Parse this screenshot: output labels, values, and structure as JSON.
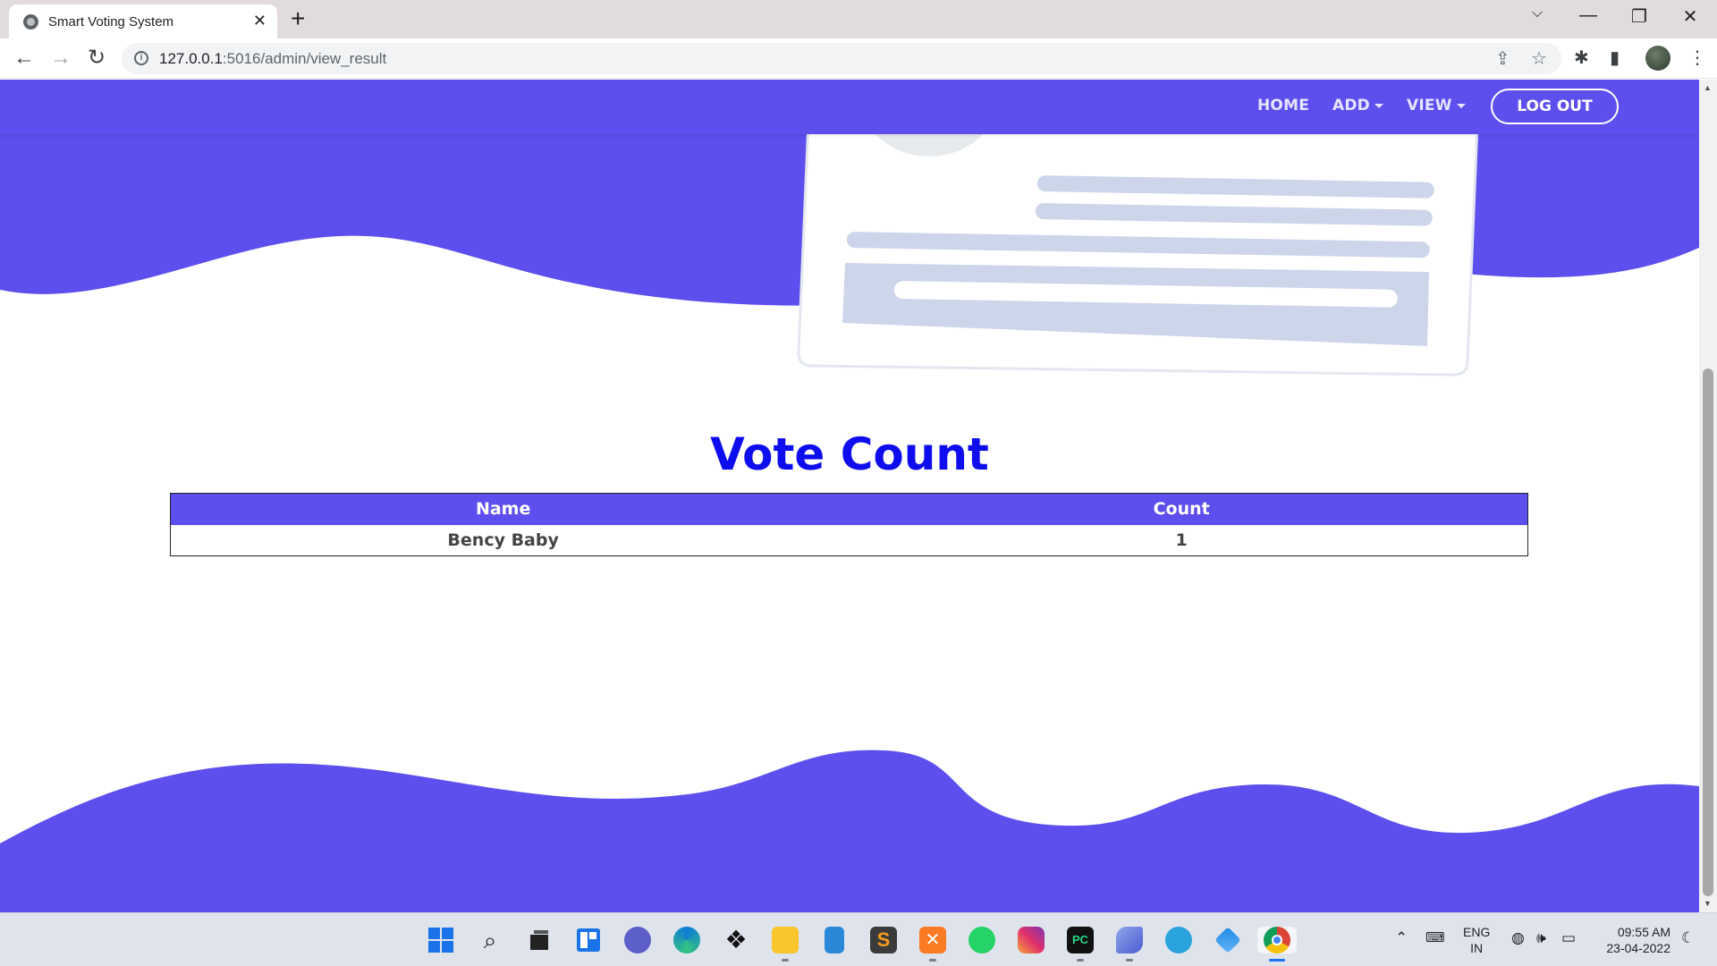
{
  "browser": {
    "tab_title": "Smart Voting System",
    "tab_close": "✕",
    "new_tab": "+",
    "url_host": "127.0.0.1",
    "url_path": ":5016/admin/view_result",
    "window_controls": [
      "⌵",
      "—",
      "❐",
      "✕"
    ]
  },
  "navbar": {
    "home": "HOME",
    "add": "ADD",
    "view": "VIEW",
    "logout": "LOG OUT"
  },
  "colors": {
    "brand": "#5d4fed",
    "title": "#0d0ded",
    "illustration": "#ccd5ea"
  },
  "main": {
    "title": "Vote Count",
    "table": {
      "headers": [
        "Name",
        "Count"
      ],
      "rows": [
        [
          "Bency Baby",
          "1"
        ]
      ]
    }
  },
  "taskbar": {
    "lang": "ENG",
    "region": "IN",
    "time": "09:55 AM",
    "date": "23-04-2022",
    "apps": [
      "start-icon",
      "search-icon",
      "task-view-icon",
      "widgets-icon",
      "chat-icon",
      "edge-icon",
      "dropbox-icon",
      "file-explorer-icon",
      "notepad-icon",
      "sublime-icon",
      "xampp-icon",
      "whatsapp-icon",
      "instagram-icon",
      "pycharm-icon",
      "bird-app-icon",
      "telegram-icon",
      "vpn-icon",
      "chrome-icon"
    ]
  }
}
